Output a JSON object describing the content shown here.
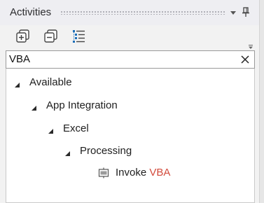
{
  "panel": {
    "title": "Activities"
  },
  "titlebar": {
    "dropdown_icon": "chevron-down-icon",
    "pin_icon": "pin-icon"
  },
  "toolbar": {
    "buttons": [
      {
        "name": "expand-all",
        "icon": "expand-all-icon"
      },
      {
        "name": "collapse-all",
        "icon": "collapse-all-icon"
      },
      {
        "name": "filter-options",
        "icon": "list-options-icon"
      }
    ]
  },
  "search": {
    "value": "VBA",
    "clear_icon": "close-icon"
  },
  "tree": {
    "nodes": [
      {
        "label": "Available",
        "level": 0,
        "expanded": true
      },
      {
        "label": "App Integration",
        "level": 1,
        "expanded": true
      },
      {
        "label": "Excel",
        "level": 2,
        "expanded": true
      },
      {
        "label": "Processing",
        "level": 3,
        "expanded": true
      },
      {
        "label_prefix": "Invoke ",
        "label_match": "VBA",
        "level": 4,
        "icon": "activity-icon"
      }
    ]
  },
  "colors": {
    "match_highlight": "#d24b3c",
    "icon_accent": "#1e6fb8"
  }
}
